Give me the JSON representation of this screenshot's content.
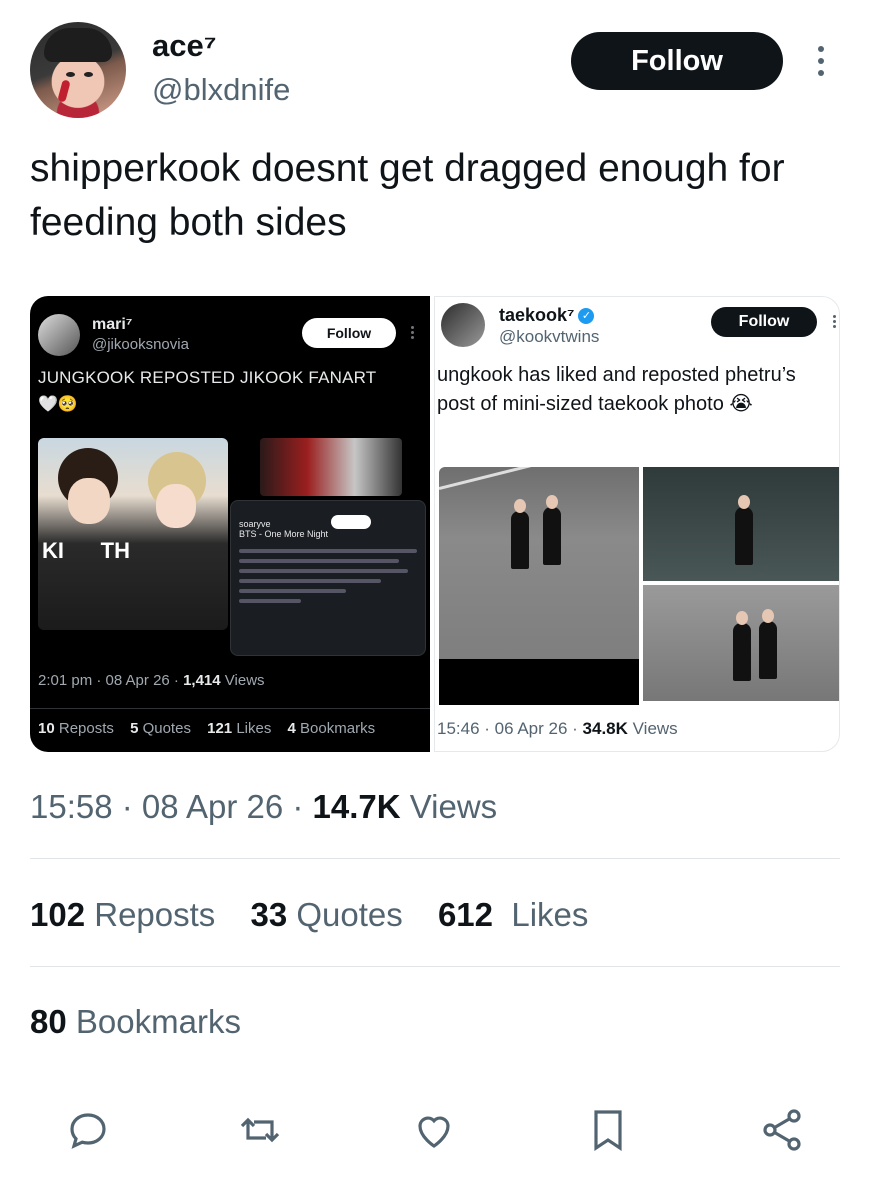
{
  "author": {
    "name": "ace⁷",
    "handle": "@blxdnife",
    "follow_label": "Follow"
  },
  "tweet": {
    "text": "shipperkook doesnt get dragged enough for feeding both sides"
  },
  "media_left": {
    "name": "mari⁷",
    "handle": "@jikooksnovia",
    "follow_label": "Follow",
    "text": "JUNGKOOK REPOSTED JIKOOK FANART",
    "emoji": "🤍🥺",
    "card_user": "soaryve",
    "card_sub": "BTS - One More Night",
    "time": "2:01 pm · 08 Apr 26 · ",
    "views_count": "1,414",
    "views_label": " Views",
    "stats": [
      {
        "count": "10",
        "label": "Reposts"
      },
      {
        "count": "5",
        "label": "Quotes"
      },
      {
        "count": "121",
        "label": "Likes"
      },
      {
        "count": "4",
        "label": "Bookmarks"
      }
    ]
  },
  "media_right": {
    "name": "taekook⁷",
    "handle": "@kookvtwins",
    "follow_label": "Follow",
    "text": "ungkook has liked and reposted phetru’s post of mini-sized taekook photo 😭",
    "time": "15:46 · 06 Apr 26 · ",
    "views_count": "34.8K",
    "views_label": " Views"
  },
  "meta": {
    "time": "15:58 · 08 Apr 26 · ",
    "views_count": "14.7K",
    "views_label": " Views"
  },
  "stats": {
    "reposts_count": "102",
    "reposts_label": "Reposts",
    "quotes_count": "33",
    "quotes_label": "Quotes",
    "likes_count": "612",
    "likes_label": "Likes",
    "bookmarks_count": "80",
    "bookmarks_label": "Bookmarks"
  },
  "icons": [
    "reply-icon",
    "retweet-icon",
    "like-icon",
    "bookmark-icon",
    "share-icon"
  ],
  "colors": {
    "text": "#0f1419",
    "secondary": "#536471",
    "accent": "#1d9bf0",
    "follow_bg": "#0f1419"
  }
}
